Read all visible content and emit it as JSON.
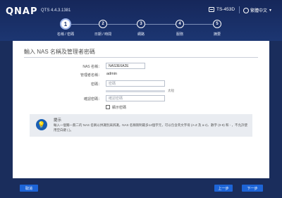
{
  "header": {
    "brand": "QNAP",
    "version": "QTS 4.4.3.1381",
    "model": "TS-453D",
    "language": "繁體中文"
  },
  "steps": [
    {
      "number": "1",
      "label": "名稱 / 密碼"
    },
    {
      "number": "2",
      "label": "日期 / 時間"
    },
    {
      "number": "3",
      "label": "網路"
    },
    {
      "number": "4",
      "label": "服務"
    },
    {
      "number": "5",
      "label": "摘要"
    }
  ],
  "active_step": 1,
  "form": {
    "title": "輸入 NAS 名稱及管理者密碼",
    "nas_name_label": "NAS 名稱：",
    "nas_name_value": "NAS3E6A2E",
    "admin_label": "管理者名稱：",
    "admin_value": "admin",
    "password_label": "密碼：",
    "password_placeholder": "密碼",
    "strength_label": "太短",
    "strength_level": 0.0,
    "confirm_label": "確認密碼：",
    "confirm_placeholder": "確認密碼",
    "show_password_label": "顯示密碼"
  },
  "hint": {
    "title": "提示",
    "text": "輸入一個獨一無二的 NAS 名稱以供識別與辨識。NAS 名稱限制最多14個字元，可以包含英文字母 (A-Z 及 a-z)、數字 (0-9) 和 - ，不允許使用空白鍵 (.)。"
  },
  "footer": {
    "cancel_label": "取消",
    "back_label": "上一步",
    "next_label": "下一步"
  },
  "colors": {
    "header_bg": "#16275a",
    "accent": "#1d64d6",
    "hint_icon": "#1a5fb4"
  }
}
